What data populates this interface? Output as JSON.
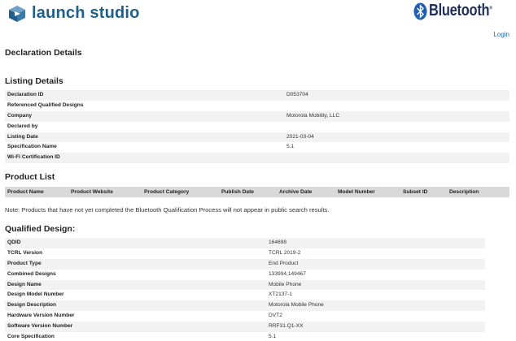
{
  "header": {
    "app_name": "launch studio",
    "brand_name": "Bluetooth",
    "brand_mark": "®",
    "login": "Login"
  },
  "page_title": "Declaration Details",
  "listing": {
    "title": "Listing Details",
    "rows": [
      {
        "label": "Declaration ID",
        "value": "D053704"
      },
      {
        "label": "Referenced Qualified Designs",
        "value": ""
      },
      {
        "label": "Company",
        "value": "Motorola Mobility, LLC"
      },
      {
        "label": "Declared by",
        "value": ""
      },
      {
        "label": "Listing Date",
        "value": "2021-03-04"
      },
      {
        "label": "Specification Name",
        "value": "5.1"
      },
      {
        "label": "Wi-Fi Certification ID",
        "value": ""
      }
    ]
  },
  "product_list": {
    "title": "Product List",
    "columns": [
      "Product Name",
      "Product Website",
      "Product Category",
      "Publish Date",
      "Archive Date",
      "Model Number",
      "Subset ID",
      "Description"
    ],
    "note": "Note: Products that have not yet completed the Bluetooth Qualification Process will not appear in public search results."
  },
  "qualified": {
    "title": "Qualified Design:",
    "rows": [
      {
        "label": "QDID",
        "value": "164698"
      },
      {
        "label": "TCRL Version",
        "value": "TCRL 2019-2"
      },
      {
        "label": "Product Type",
        "value": "End Product"
      },
      {
        "label": "Combined Designs",
        "value": "133994,149467"
      },
      {
        "label": "Design Name",
        "value": "Mobile Phone"
      },
      {
        "label": "Design Model Number",
        "value": "XT2137-1"
      },
      {
        "label": "Design Description",
        "value": "Motorola Mobile Phone"
      },
      {
        "label": "Hardware Version Number",
        "value": "DVT2"
      },
      {
        "label": "Software Version Number",
        "value": "RRF31.Q1-XX"
      },
      {
        "label": "Core Specification",
        "value": "5.1"
      }
    ]
  },
  "colors": {
    "logo_blue": "#1f5f8b",
    "link": "#2b6aa3",
    "brand_navy": "#1d2f58"
  },
  "icons": [
    "launch-studio-logo-icon",
    "bluetooth-rune-icon"
  ]
}
